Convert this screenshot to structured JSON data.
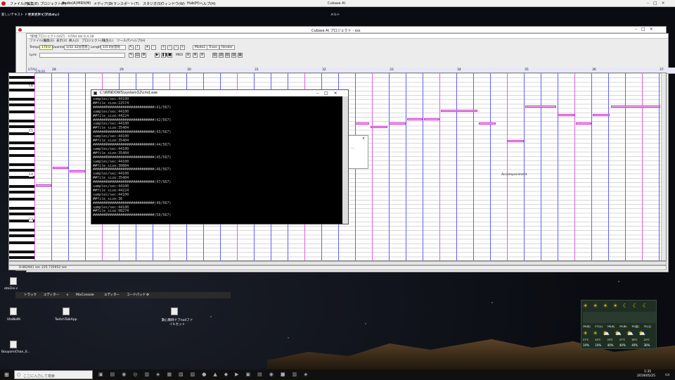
{
  "outer": {
    "app_title": "Cubase AI",
    "menus": [
      "ファイル(F)",
      "編集(E)",
      "プロジェクト(P)",
      "Audio(A)",
      "MIDI(M)",
      "メディア(D)",
      "トランスポート(T)",
      "スタジオ(S)",
      "ウィンドウ(W)",
      "Hub(H)",
      "ヘルプ(H)"
    ]
  },
  "project": {
    "title": "Cubase AI プロジェクト - sss",
    "utau_title": "*新規プロジェクト(UST) - UTAU Ver.0.4.18",
    "menus": [
      "ファイル(F)",
      "編集(E)",
      "表示(V)",
      "挿入(I)",
      "プロジェクト(P)",
      "再生(L)",
      "ツール(T)",
      "ヘルプ(H)"
    ]
  },
  "toolbar": {
    "tempo_label": "Tempo",
    "tempo_value": "170.0",
    "quantize_label": "Quantize",
    "quantize_value": "1/32 32分音符",
    "length_label": "Length",
    "length_value": "1/4 4分音符",
    "mode2": "Mode2",
    "trace": "Trace",
    "render": "Render",
    "lyric_label": "Lyric",
    "midi_label": "MIDI"
  },
  "roll": {
    "header": "UTAU",
    "octaves": [
      "C6",
      "C5",
      "C4",
      "C3"
    ],
    "bars": [
      "28",
      "29",
      "30",
      "31",
      "32",
      "33",
      "34",
      "35",
      "36",
      "37"
    ],
    "marker": "178.00",
    "time_a": "0.062941 sec",
    "time_b": "225.735952 sec",
    "sheet_label": "Accompaniment"
  },
  "cmd": {
    "title": "C:\\WINDOWS\\system32\\cmd.exe",
    "lines": [
      "samples/sec:44100",
      "##file_size:22574",
      "#############################(41/567)",
      "samples/sec:44100",
      "##file_size:44224",
      "#############################(42/567)",
      "samples/sec:44100",
      "##file_size:35404",
      "#############################(43/567)",
      "samples/sec:44100",
      "##file_size:35404",
      "#############################(44/567)",
      "samples/sec:44100",
      "##file_size:35404",
      "#############################(45/567)",
      "samples/sec:44100",
      "##file_size:30884",
      "#############################(46/567)",
      "samples/sec:44100",
      "##file_size:35404",
      "#############################(47/567)",
      "samples/sec:44100",
      "##file_size:44224",
      "samples/sec:44100",
      "##file_size:36",
      "#############################(49/567)",
      "samples/sec:44100",
      "##file_size:98274",
      "#############################(50/567)"
    ]
  },
  "tabs": [
    "トラック",
    "エディター",
    "MixConsole",
    "エディター",
    "コードパッド"
  ],
  "desktop": {
    "icons": [
      "新しいテキスト ドキュメント.txt",
      "UtaNoMi",
      "TwitchTalkApp",
      "歌心教師ドアnodファイルセット",
      "BouyomiChan_0...",
      "oto2ini.c"
    ],
    "top_icons": [
      "新しいテキスト ドキュメント (2).txt",
      "世界世界 ビデオ.mp3",
      "メルト"
    ]
  },
  "weather": {
    "days": [
      "28(月)",
      "27(火)",
      "26(水)",
      "25(木)",
      "30(金)",
      "31(土)"
    ],
    "pct": [
      "10%",
      "10%",
      "40%",
      "40%",
      "40%",
      "30%"
    ],
    "temps": [
      "27℃",
      "24℃",
      "25℃",
      "27℃",
      "26℃",
      "22℃"
    ]
  },
  "taskbar": {
    "search_placeholder": "ここに入力して検索",
    "time": "1:35",
    "date": "2019/05/25"
  }
}
